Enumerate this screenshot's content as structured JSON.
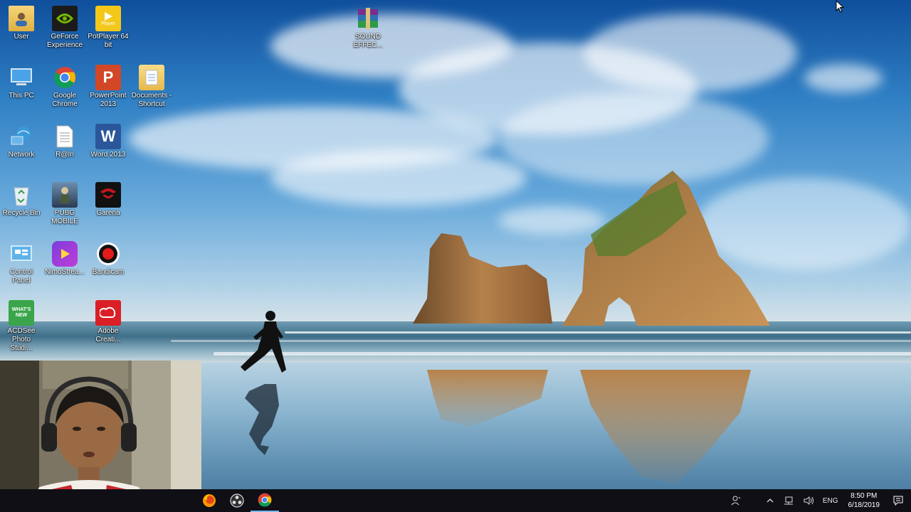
{
  "desktop": {
    "icons": [
      {
        "label": "User",
        "icon": "user-folder-icon"
      },
      {
        "label": "GeForce Experience",
        "icon": "nvidia-icon"
      },
      {
        "label": "PotPlayer 64 bit",
        "icon": "potplayer-icon"
      },
      {
        "label": "SOUND EFFEC...",
        "icon": "winrar-archive-icon"
      },
      {
        "label": "This PC",
        "icon": "this-pc-icon"
      },
      {
        "label": "Google Chrome",
        "icon": "chrome-icon"
      },
      {
        "label": "PowerPoint 2013",
        "icon": "powerpoint-icon"
      },
      {
        "label": "Documents - Shortcut",
        "icon": "documents-shortcut-icon"
      },
      {
        "label": "Network",
        "icon": "network-icon"
      },
      {
        "label": "R@In",
        "icon": "text-file-icon"
      },
      {
        "label": "Word 2013",
        "icon": "word-icon"
      },
      {
        "label": "Recycle Bin",
        "icon": "recycle-bin-icon"
      },
      {
        "label": "PUBG MOBILE",
        "icon": "pubg-icon"
      },
      {
        "label": "Garena",
        "icon": "garena-icon"
      },
      {
        "label": "Control Panel",
        "icon": "control-panel-icon"
      },
      {
        "label": "NimoStrea...",
        "icon": "nimo-stream-icon"
      },
      {
        "label": "Bandicam",
        "icon": "bandicam-icon"
      },
      {
        "label": "ACDSee Photo Studi...",
        "icon": "acdsee-icon"
      },
      {
        "label": "Adobe Creati...",
        "icon": "adobe-cc-icon"
      }
    ],
    "acdsee_badge": "WHAT'S NEW",
    "potplayer_badge": "Player",
    "powerpoint_letter": "P",
    "word_letter": "W"
  },
  "taskbar": {
    "apps": [
      "firefox-icon",
      "obs-icon",
      "chrome-icon"
    ],
    "tray": {
      "language": "ENG",
      "time": "8:50 PM",
      "date": "6/18/2019"
    }
  },
  "colors": {
    "taskbar": "#0f0f15",
    "nvidia": "#76b900",
    "potplayer": "#f3c81a",
    "powerpoint": "#d24726",
    "word": "#2b579a",
    "garena": "#c4161c",
    "adobe": "#da1f26"
  }
}
